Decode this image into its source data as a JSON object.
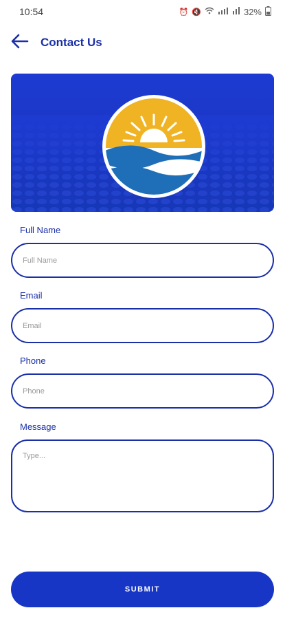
{
  "status_bar": {
    "time": "10:54",
    "battery": "32%"
  },
  "header": {
    "title": "Contact Us"
  },
  "form": {
    "full_name": {
      "label": "Full Name",
      "placeholder": "Full Name"
    },
    "email": {
      "label": "Email",
      "placeholder": "Email"
    },
    "phone": {
      "label": "Phone",
      "placeholder": "Phone"
    },
    "message": {
      "label": "Message",
      "placeholder": "Type..."
    }
  },
  "submit_label": "SUBMIT",
  "colors": {
    "primary": "#1A2FA8",
    "button": "#1736C6",
    "sun": "#F0B323",
    "wave": "#1E6FB8"
  }
}
